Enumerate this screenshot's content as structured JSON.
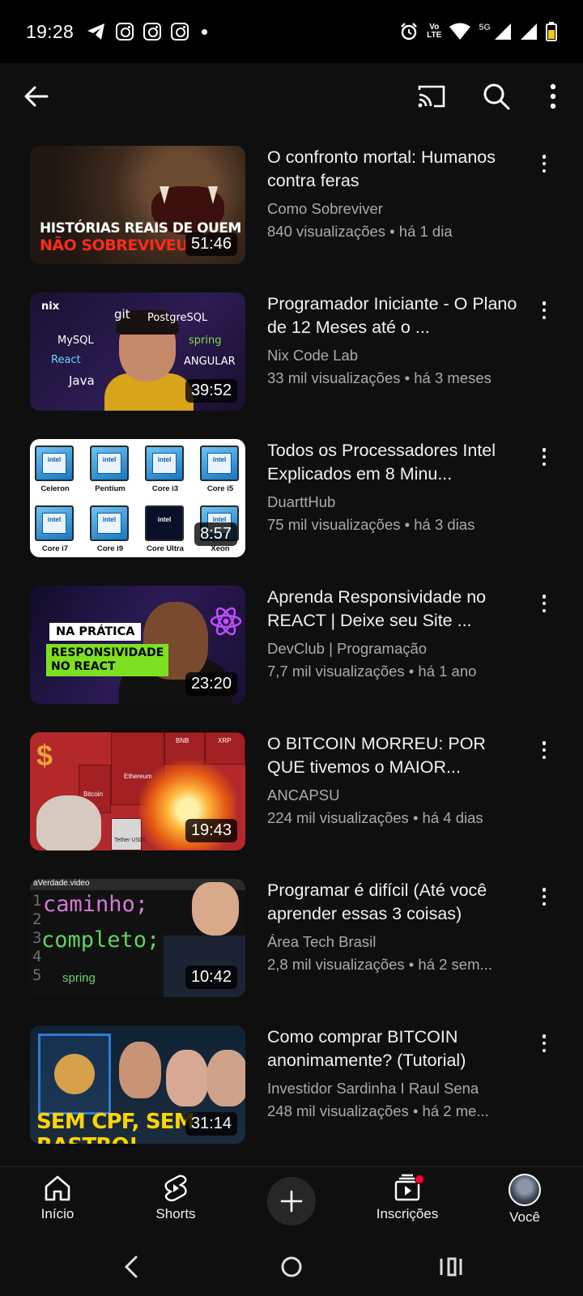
{
  "status_bar": {
    "time": "19:28",
    "network_label_top": "Vo",
    "network_label_mid": "LTE",
    "network_5g": "5G",
    "icons": [
      "telegram-icon",
      "instagram-icon",
      "instagram-icon",
      "instagram-icon",
      "alarm-icon",
      "wifi-icon",
      "signal-icon",
      "battery-icon"
    ]
  },
  "app_bar": {
    "icons": [
      "back-arrow-icon",
      "cast-icon",
      "search-icon",
      "more-vert-icon"
    ]
  },
  "videos": [
    {
      "title": "O confronto mortal: Humanos contra feras",
      "channel": "Como Sobreviver",
      "meta": "840 visualizações • há 1 dia",
      "duration": "51:46",
      "thumb_text": [
        "HISTÓRIAS REAIS DE QUEM",
        "NÃO SOBREVIVEU"
      ]
    },
    {
      "title": "Programador Iniciante - O Plano de 12 Meses até o ...",
      "channel": "Nix Code Lab",
      "meta": "33 mil visualizações • há 3 meses",
      "duration": "39:52",
      "thumb_text": [
        "nix",
        "git",
        "PostgreSQL",
        "MySQL",
        "spring",
        "React",
        "ANGULAR",
        "Java"
      ]
    },
    {
      "title": "Todos os Processadores Intel Explicados em 8 Minu...",
      "channel": "DuarttHub",
      "meta": "75 mil visualizações • há 3 dias",
      "duration": "8:57",
      "thumb_text": [
        "Celeron",
        "Pentium",
        "Core i3",
        "Core i5",
        "Core i7",
        "Core i9",
        "Core Ultra",
        "Xeon"
      ]
    },
    {
      "title": "Aprenda Responsividade no REACT | Deixe seu Site ...",
      "channel": "DevClub | Programação",
      "meta": "7,7 mil visualizações • há 1 ano",
      "duration": "23:20",
      "thumb_text": [
        "NA PRÁTICA",
        "RESPONSIVIDADE",
        "NO REACT"
      ]
    },
    {
      "title": "O BITCOIN MORREU: POR QUE tivemos o MAIOR...",
      "channel": "ANCAPSU",
      "meta": "224 mil visualizações • há 4 dias",
      "duration": "19:43",
      "thumb_text": [
        "$",
        "BNB",
        "XRP",
        "Ethereum",
        "Bitcoin",
        "Tether USDt"
      ]
    },
    {
      "title": "Programar é difícil (Até você aprender essas 3 coisas)",
      "channel": "Área Tech Brasil",
      "meta": "2,8 mil visualizações • há 2 sem...",
      "duration": "10:42",
      "thumb_text": [
        "aVerdade.video",
        "caminho;",
        "completo;",
        "spring",
        "1\n2\n3\n4\n5"
      ]
    },
    {
      "title": "Como comprar BITCOIN anonimamente? (Tutorial)",
      "channel": "Investidor Sardinha I Raul Sena",
      "meta": "248 mil visualizações • há 2 me...",
      "duration": "31:14",
      "thumb_text": [
        "SEM CPF, SEM RASTRO!"
      ]
    }
  ],
  "bottom_nav": {
    "home": "Início",
    "shorts": "Shorts",
    "subscriptions": "Inscrições",
    "you": "Você"
  },
  "colors": {
    "background": "#0f0f0f",
    "text_primary": "#f1f1f1",
    "text_secondary": "#aaaaaa",
    "badge": "#ff0033"
  }
}
